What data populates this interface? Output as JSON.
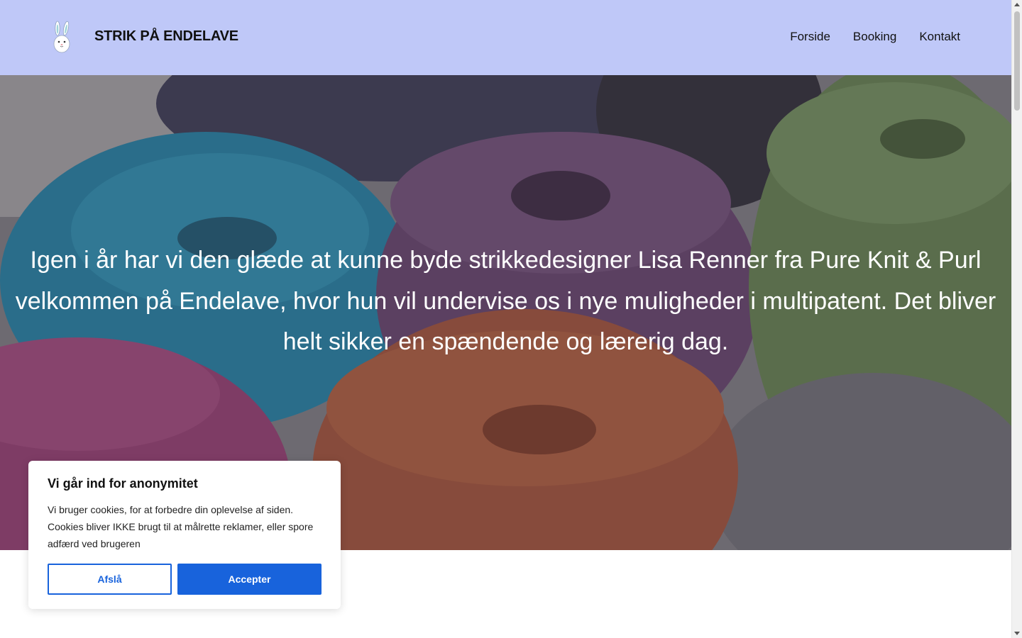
{
  "header": {
    "logo_icon": "bunny-icon",
    "site_title": "STRIK PÅ ENDELAVE",
    "background": "#bfc8f8",
    "nav": [
      {
        "label": "Forside"
      },
      {
        "label": "Booking"
      },
      {
        "label": "Kontakt"
      }
    ]
  },
  "hero": {
    "image": "yarn-balls-photo",
    "text": "Igen i år har vi den glæde at kunne byde strikkedesigner Lisa Renner fra Pure Knit & Purl velkommen på Endelave, hvor hun vil undervise os i nye muligheder i multipatent. Det bliver helt sikker en spændende og lærerig dag."
  },
  "cookie_banner": {
    "title": "Vi går ind for anonymitet",
    "text": "Vi bruger cookies, for at forbedre din oplevelse af siden. Cookies bliver IKKE brugt til at målrette reklamer, eller spore adfærd ved brugeren",
    "decline_label": "Afslå",
    "accept_label": "Accepter",
    "accent_color": "#1863dc"
  }
}
